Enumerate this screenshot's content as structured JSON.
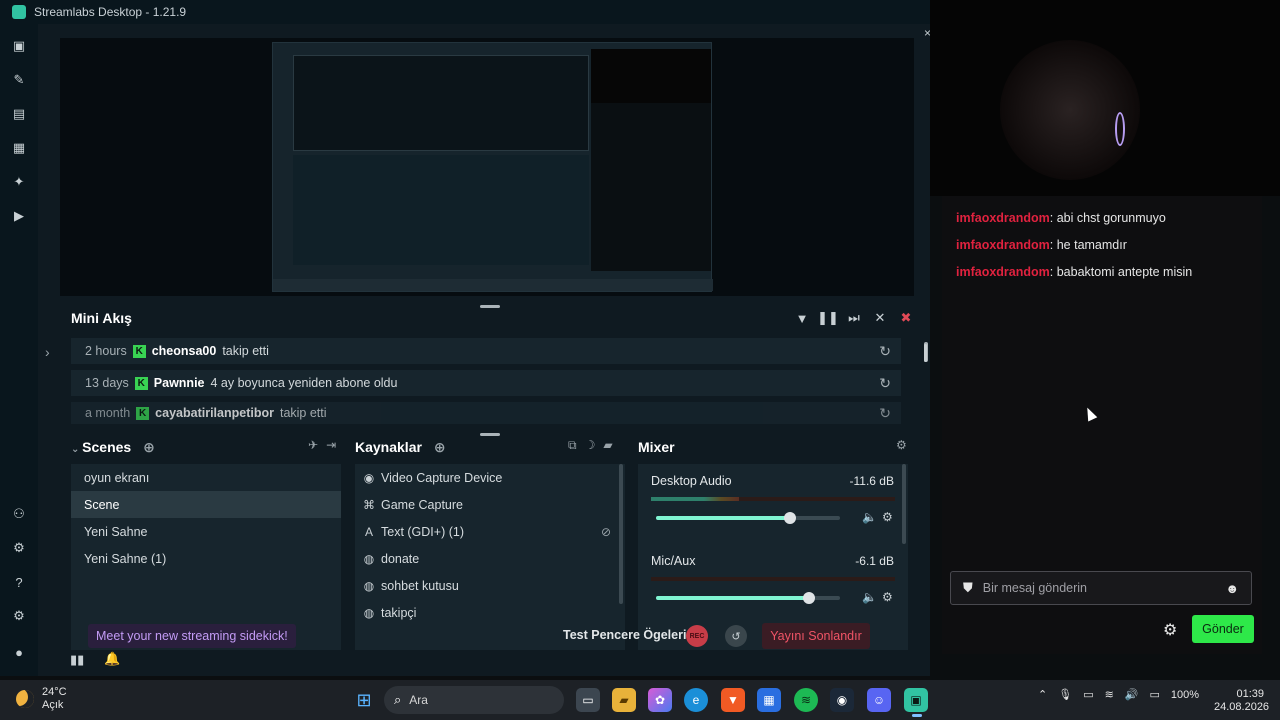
{
  "window": {
    "title": "Streamlabs Desktop - 1.21.9"
  },
  "mini_feed": {
    "title": "Mini Akış",
    "events": [
      {
        "time": "2 hours",
        "user": "cheonsa00",
        "action": "takip etti"
      },
      {
        "time": "13 days",
        "user": "Pawnnie",
        "action": "4 ay boyunca yeniden abone oldu"
      },
      {
        "time": "a month",
        "user": "cayabatirilanpetibor",
        "action": "takip etti"
      }
    ]
  },
  "scenes": {
    "title": "Scenes",
    "items": [
      "oyun ekranı",
      "Scene",
      "Yeni Sahne",
      "Yeni Sahne (1)"
    ],
    "active_index": 1
  },
  "sources": {
    "title": "Kaynaklar",
    "items": [
      {
        "label": "Video Capture Device",
        "icon": "webcam-icon"
      },
      {
        "label": "Game Capture",
        "icon": "gamepad-icon"
      },
      {
        "label": "Text (GDI+) (1)",
        "icon": "text-icon"
      },
      {
        "label": "donate",
        "icon": "globe-icon"
      },
      {
        "label": "sohbet kutusu",
        "icon": "globe-icon"
      },
      {
        "label": "takipçi",
        "icon": "globe-icon"
      }
    ]
  },
  "mixer": {
    "title": "Mixer",
    "channels": [
      {
        "name": "Desktop Audio",
        "db": "-11.6 dB",
        "volume": 0.73
      },
      {
        "name": "Mic/Aux",
        "db": "-6.1 dB",
        "volume": 0.83
      }
    ]
  },
  "footer": {
    "sidekick": "Meet your new streaming sidekick!",
    "test": "Test Pencere Ögeleri",
    "rec": "REC",
    "end_stream": "Yayını Sonlandır"
  },
  "chat": {
    "messages": [
      {
        "user": "imfaoxdrandom",
        "text": "abi chst gorunmuyo"
      },
      {
        "user": "imfaoxdrandom",
        "text": "he tamamdır"
      },
      {
        "user": "imfaoxdrandom",
        "text": "babaktomi antepte misin"
      }
    ],
    "input_placeholder": "Bir mesaj gönderin",
    "send": "Gönder"
  },
  "taskbar": {
    "temperature": "24°C",
    "condition": "Açık",
    "search": "Ara",
    "battery": "100%",
    "time": "01:39",
    "date": "24.08.2026"
  },
  "colors": {
    "accent": "#31c3a2",
    "live_red": "#f05466",
    "send_green": "#2ee849",
    "chat_user": "#e0223f"
  }
}
